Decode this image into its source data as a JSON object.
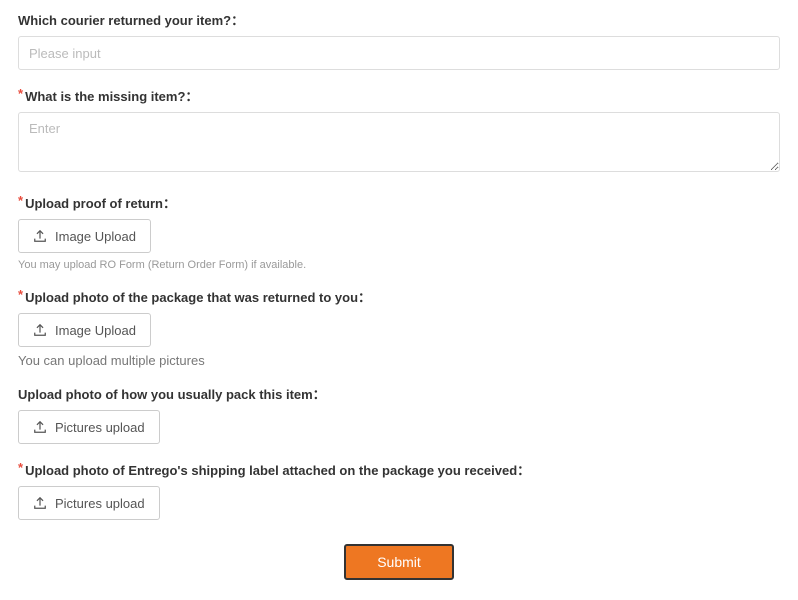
{
  "fields": {
    "courier": {
      "label": "Which courier returned your item?：",
      "placeholder": "Please input"
    },
    "missing": {
      "label": "What is the missing item?：",
      "placeholder": "Enter"
    },
    "proof": {
      "label": "Upload proof of return：",
      "button": "Image Upload",
      "hint": "You may upload RO Form (Return Order Form) if available."
    },
    "package_returned": {
      "label": "Upload photo of the package that was returned to you：",
      "button": "Image Upload",
      "hint": "You can upload multiple pictures"
    },
    "pack_usual": {
      "label": "Upload photo of how you usually pack this item：",
      "button": "Pictures upload"
    },
    "shipping_label": {
      "label": "Upload photo of Entrego's shipping label attached on the package you received：",
      "button": "Pictures upload"
    }
  },
  "submit_label": "Submit"
}
